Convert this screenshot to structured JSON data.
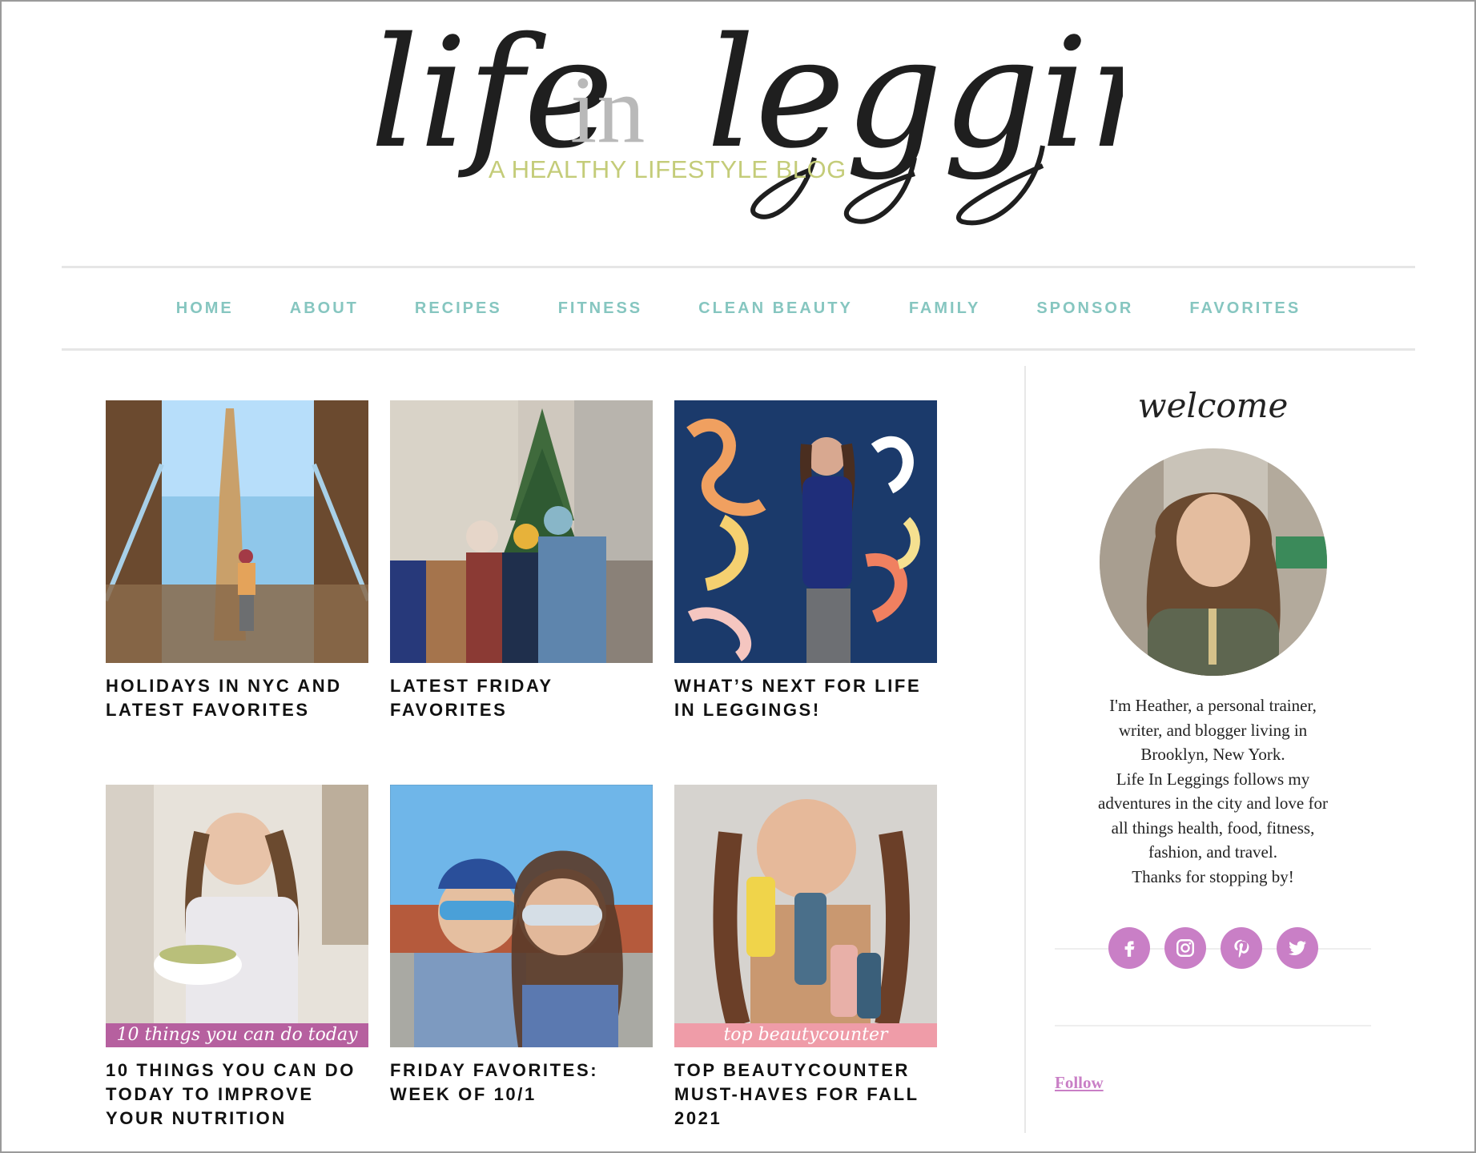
{
  "header": {
    "logo": {
      "script_life": "life",
      "script_in": "in",
      "script_leggings": "leggings",
      "tagline": "A HEALTHY LIFESTYLE BLOG"
    }
  },
  "nav": {
    "items": [
      {
        "label": "HOME"
      },
      {
        "label": "ABOUT"
      },
      {
        "label": "RECIPES"
      },
      {
        "label": "FITNESS"
      },
      {
        "label": "CLEAN BEAUTY"
      },
      {
        "label": "FAMILY"
      },
      {
        "label": "SPONSOR"
      },
      {
        "label": "FAVORITES"
      }
    ],
    "color": "#86c6c0"
  },
  "posts": [
    {
      "title": "HOLIDAYS IN NYC AND LATEST FAVORITES",
      "banner": ""
    },
    {
      "title": "LATEST FRIDAY FAVORITES",
      "banner": ""
    },
    {
      "title": "WHAT’S NEXT FOR LIFE IN LEGGINGS!",
      "banner": ""
    },
    {
      "title": "10 THINGS YOU CAN DO TODAY TO IMPROVE YOUR NUTRITION",
      "banner": "10 things you can do today"
    },
    {
      "title": "FRIDAY FAVORITES: WEEK OF 10/1",
      "banner": ""
    },
    {
      "title": "TOP BEAUTYCOUNTER MUST-HAVES FOR FALL 2021",
      "banner": "top beautycounter"
    }
  ],
  "sidebar": {
    "welcome": "welcome",
    "bio_lines": [
      "I'm Heather, a personal trainer,",
      "writer, and blogger living in",
      "Brooklyn, New York.",
      "Life In Leggings follows my",
      "adventures in the city and love for",
      "all things health, food, fitness,",
      "fashion, and travel.",
      "Thanks for stopping by!"
    ],
    "social": [
      {
        "icon": "facebook-icon"
      },
      {
        "icon": "instagram-icon"
      },
      {
        "icon": "pinterest-icon"
      },
      {
        "icon": "twitter-icon"
      }
    ],
    "social_color": "#c97fc6",
    "follow_label": "Follow"
  }
}
